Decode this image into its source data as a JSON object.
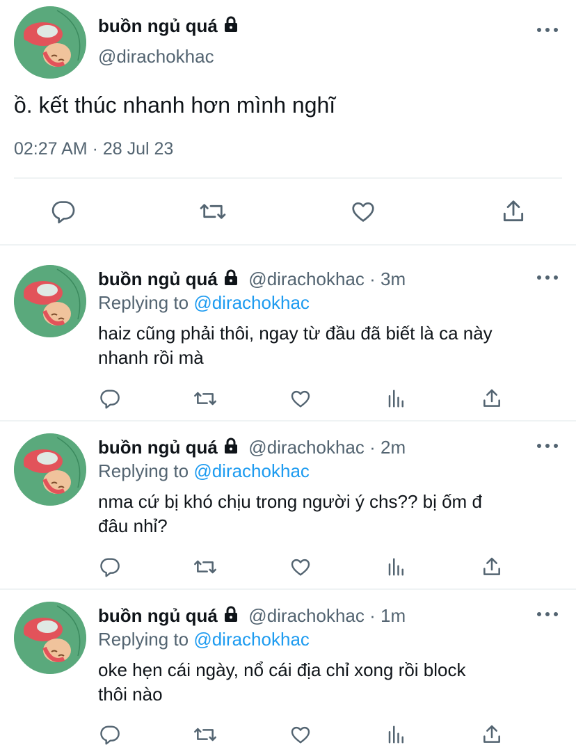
{
  "main_tweet": {
    "display_name": "buồn ngủ quá",
    "handle": "@dirachokhac",
    "text": "ồ. kết thúc nhanh hơn mình nghĩ",
    "timestamp": "02:27 AM · 28 Jul 23",
    "actions": [
      "reply-icon",
      "retweet-icon",
      "like-icon",
      "share-icon"
    ]
  },
  "replies": [
    {
      "display_name": "buồn ngủ quá",
      "handle_time": "@dirachokhac · 3m",
      "replying_prefix": "Replying to",
      "replying_handle": "@dirachokhac",
      "text_line1": "haiz cũng phải thôi, ngay từ đầu đã biết là ca này",
      "text_line2": "nhanh rồi mà"
    },
    {
      "display_name": "buồn ngủ quá",
      "handle_time": "@dirachokhac · 2m",
      "replying_prefix": "Replying to",
      "replying_handle": "@dirachokhac",
      "text_line1": "nma cứ bị khó chịu trong người ý chs?? bị ốm đ",
      "text_line2": "đâu nhỉ?"
    },
    {
      "display_name": "buồn ngủ quá",
      "handle_time": "@dirachokhac · 1m",
      "replying_prefix": "Replying to",
      "replying_handle": "@dirachokhac",
      "text_line1": "oke hẹn cái ngày, nổ cái địa chỉ xong rồi block",
      "text_line2": "thôi nào"
    }
  ],
  "colors": {
    "link": "#1d9bf0",
    "secondary_text": "#536471",
    "avatar_bg": "#5aa97c",
    "divider": "#eff3f4"
  }
}
